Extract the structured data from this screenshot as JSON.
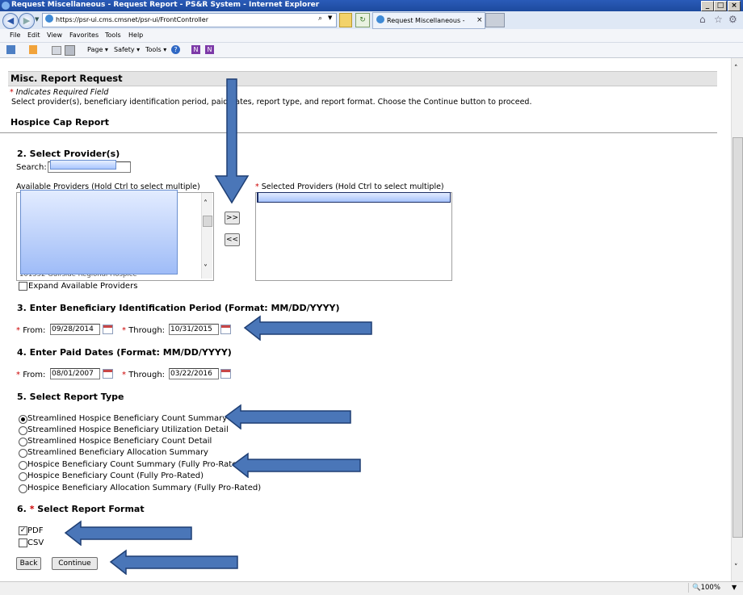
{
  "browser": {
    "window_title": "Request Miscellaneous - Request Report - PS&R System - Internet Explorer",
    "url": "https://psr-ui.cms.cmsnet/psr-ui/FrontController",
    "tab_title": "Request Miscellaneous - Req...",
    "menu": [
      "File",
      "Edit",
      "View",
      "Favorites",
      "Tools",
      "Help"
    ],
    "commands": {
      "page": "Page ▾",
      "safety": "Safety ▾",
      "tools": "Tools ▾"
    },
    "zoom": "100%"
  },
  "page": {
    "header": "Misc. Report Request",
    "required_note": "Indicates Required Field",
    "instructions": "Select provider(s), beneficiary identification period, paid dates, report type, and report format. Choose the Continue button to proceed.",
    "report_name": "Hospice Cap Report"
  },
  "providers": {
    "title": "2.  Select Provider(s)",
    "search_label": "Search:",
    "available_label": "Available Providers  (Hold Ctrl to select multiple)",
    "selected_label": "Selected Providers  (Hold Ctrl to select multiple)",
    "visible_item": "101552 Gulfside Regional Hospice",
    "add_button": ">>",
    "remove_button": "<<",
    "expand_label": "Expand Available Providers"
  },
  "beneficiary": {
    "title": "3.  Enter Beneficiary Identification Period (Format: MM/DD/YYYY)",
    "from_label": "From:",
    "from_value": "09/28/2014",
    "through_label": "Through:",
    "through_value": "10/31/2015"
  },
  "paid": {
    "title": "4.  Enter Paid Dates (Format: MM/DD/YYYY)",
    "from_label": "From:",
    "from_value": "08/01/2007",
    "through_label": "Through:",
    "through_value": "03/22/2016"
  },
  "report_type": {
    "title": "5.  Select Report Type",
    "options": [
      {
        "label": "Streamlined Hospice Beneficiary Count Summary",
        "selected": true
      },
      {
        "label": "Streamlined Hospice Beneficiary Utilization Detail",
        "selected": false
      },
      {
        "label": "Streamlined Hospice Beneficiary Count Detail",
        "selected": false
      },
      {
        "label": "Streamlined Beneficiary Allocation Summary",
        "selected": false
      },
      {
        "label": "Hospice Beneficiary Count Summary (Fully Pro-Rated)",
        "selected": false
      },
      {
        "label": "Hospice Beneficiary Count (Fully Pro-Rated)",
        "selected": false
      },
      {
        "label": "Hospice Beneficiary Allocation Summary (Fully Pro-Rated)",
        "selected": false
      }
    ]
  },
  "report_format": {
    "title_prefix": "6.",
    "title_text": "Select Report Format",
    "pdf_label": "PDF",
    "pdf_checked": true,
    "csv_label": "CSV",
    "csv_checked": false
  },
  "buttons": {
    "back": "Back",
    "continue": "Continue"
  },
  "glyphs": {
    "asterisk": "*",
    "check": "✓",
    "up": "˄",
    "down": "˅"
  },
  "colors": {
    "title_bar": "#2a5bb8",
    "section_header": "#e4e4e4",
    "required": "#cc0000",
    "annotation_arrow": "#4a76b8"
  }
}
